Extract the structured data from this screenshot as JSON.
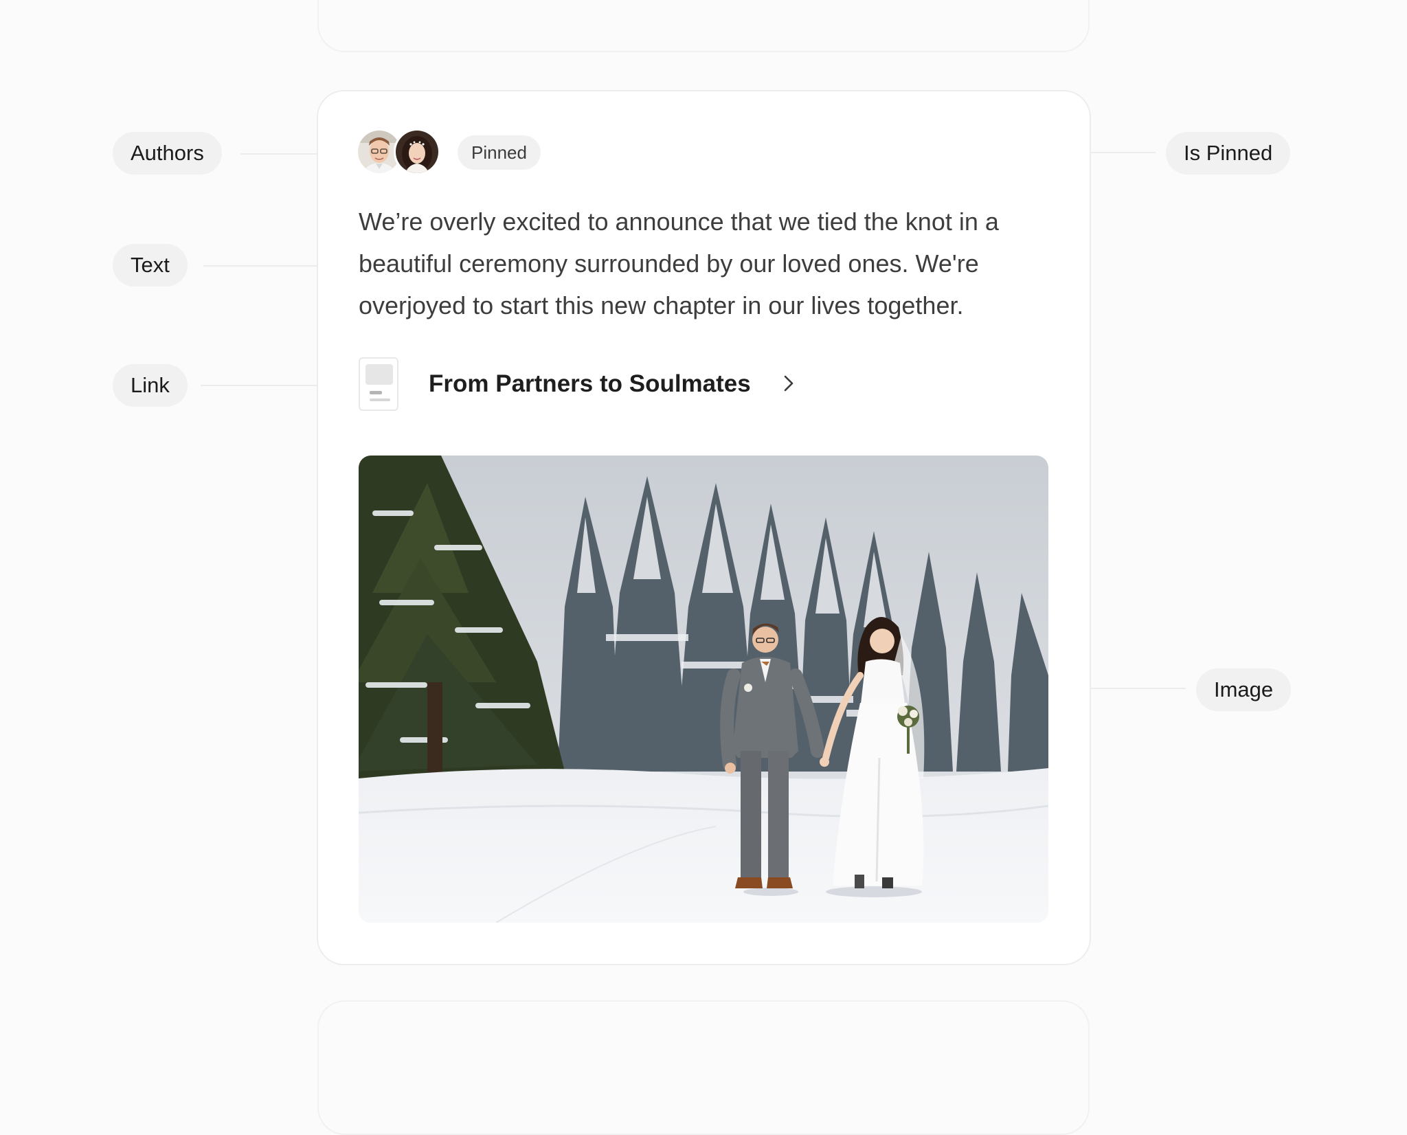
{
  "annotations": {
    "authors": "Authors",
    "text": "Text",
    "link": "Link",
    "is_pinned": "Is Pinned",
    "image": "Image"
  },
  "post": {
    "pinned_label": "Pinned",
    "text": "We’re overly excited to announce that we tied the knot in a beautiful ceremony surrounded by our loved ones. We're overjoyed to start this new chapter in our lives together.",
    "link": {
      "title": "From Partners to Soulmates"
    },
    "authors": [
      {
        "icon": "groom-avatar"
      },
      {
        "icon": "bride-avatar"
      }
    ],
    "image": {
      "icon": "wedding-photo-snowy-forest"
    }
  },
  "colors": {
    "background": "#fbfbfb",
    "card": "#ffffff",
    "chip": "#f1f1f1",
    "text": "#3d3d3d",
    "title": "#1e1e1e"
  }
}
